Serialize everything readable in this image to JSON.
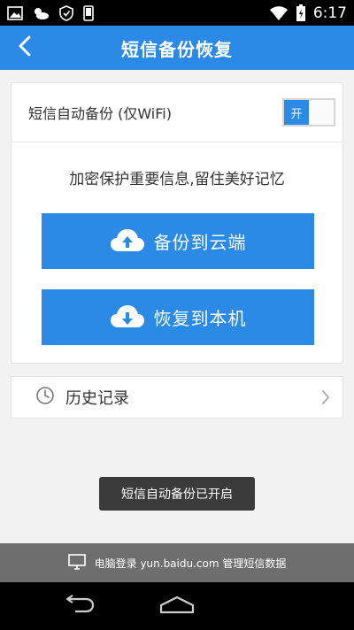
{
  "status_bar": {
    "time": "6:17",
    "left_icons": [
      "image-icon",
      "weather-icon",
      "shield-icon",
      "phone-icon"
    ],
    "right_icons": [
      "wifi-icon",
      "battery-icon"
    ]
  },
  "header": {
    "title": "短信备份恢复",
    "back_icon": "chevron-left-icon"
  },
  "settings": {
    "auto_backup_label": "短信自动备份 (仅WiFi)",
    "toggle_label": "开",
    "toggle_state": "on"
  },
  "slogan": "加密保护重要信息,留住美好记忆",
  "buttons": {
    "backup_cloud": "备份到云端",
    "restore_local": "恢复到本机"
  },
  "history": {
    "label": "历史记录"
  },
  "toast": "短信自动备份已开启",
  "footer": {
    "text": "电脑登录 yun.baidu.com 管理短信数据"
  },
  "colors": {
    "primary": "#2a8ae6",
    "background": "#f2f2f2",
    "toast": "#3b3b3b",
    "footer": "#6e6e6e"
  }
}
